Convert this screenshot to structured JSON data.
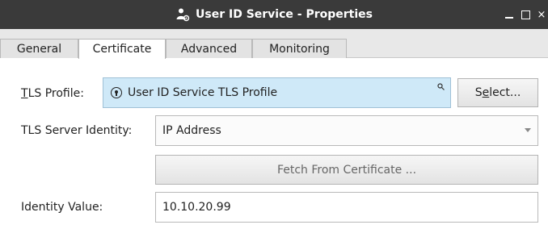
{
  "window": {
    "title": "User ID Service - Properties",
    "controls": {
      "minimize": "_",
      "maximize": "□",
      "close": "×"
    }
  },
  "tabs": [
    {
      "label": "General",
      "active": false
    },
    {
      "label": "Certificate",
      "active": true
    },
    {
      "label": "Advanced",
      "active": false
    },
    {
      "label": "Monitoring",
      "active": false
    }
  ],
  "form": {
    "tls_profile": {
      "label_underlined": "T",
      "label_rest": "LS Profile:",
      "value": "User ID Service TLS Profile",
      "select_button_prefix": "S",
      "select_button_underlined": "e",
      "select_button_suffix": "lect..."
    },
    "tls_server_identity": {
      "label": "TLS Server Identity:",
      "value": "IP Address"
    },
    "fetch_button": "Fetch From Certificate ...",
    "identity_value": {
      "label": "Identity Value:",
      "value": "10.10.20.99"
    }
  },
  "icons": {
    "title": "user-gear-icon",
    "profile": "lock-icon",
    "field_search": "search-icon",
    "dropdown": "chevron-down-icon"
  },
  "colors": {
    "titlebar": "#3a3a3a",
    "tab_bar": "#e8e8e8",
    "profile_field_bg": "#cfe9f8"
  }
}
